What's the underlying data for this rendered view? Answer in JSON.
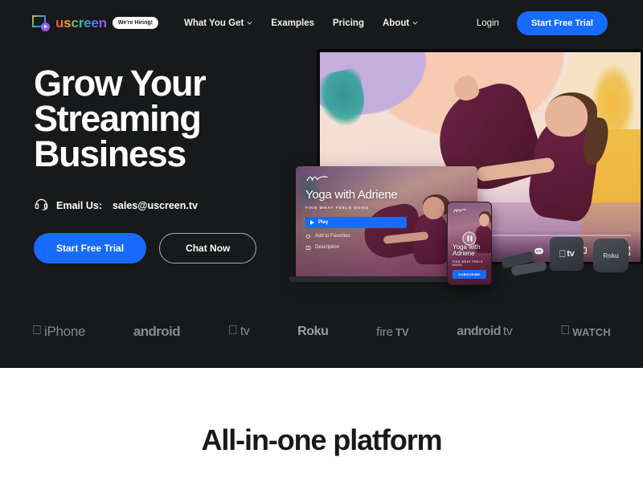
{
  "brand": {
    "name": "uscreen",
    "hiring_badge": "We're Hiring!",
    "logo_icon": "uscreen-play-logo-icon"
  },
  "nav": {
    "items": [
      {
        "label": "What You Get",
        "has_dropdown": true
      },
      {
        "label": "Examples",
        "has_dropdown": false
      },
      {
        "label": "Pricing",
        "has_dropdown": false
      },
      {
        "label": "About",
        "has_dropdown": true
      }
    ],
    "login_label": "Login",
    "cta_label": "Start Free Trial"
  },
  "hero": {
    "title_line1": "Grow Your",
    "title_line2": "Streaming",
    "title_line3": "Business",
    "email_icon": "headset-support-icon",
    "email_label": "Email Us:",
    "email_value": "sales@uscreen.tv",
    "primary_cta": "Start Free Trial",
    "secondary_cta": "Chat Now"
  },
  "showcase": {
    "laptop": {
      "title": "Yoga with Adriene",
      "subtitle": "FIND WHAT FEELS GOOD",
      "play_label": "Play",
      "favorites_label": "Add to Favorites",
      "description_label": "Description"
    },
    "phone": {
      "title": "Yoga with Adriene",
      "subtitle": "FIND WHAT FEELS GOOD",
      "subscribe_label": "SUBSCRIBE"
    },
    "player_controls": [
      "closed-captions-icon",
      "picture-in-picture-icon",
      "cast-icon",
      "settings-gear-icon",
      "fullscreen-icon"
    ],
    "devices": [
      {
        "name": "fire-tv-stick"
      },
      {
        "name": "apple-tv-box",
        "label": "tv"
      },
      {
        "name": "roku-box",
        "label": "Roku"
      }
    ]
  },
  "platforms": [
    {
      "key": "iphone",
      "apple": true,
      "text": "iPhone"
    },
    {
      "key": "android",
      "apple": false,
      "text": "android"
    },
    {
      "key": "apple-tv",
      "apple": true,
      "text": "tv"
    },
    {
      "key": "roku",
      "apple": false,
      "text": "Roku"
    },
    {
      "key": "fire-tv",
      "apple": false,
      "text": "fire",
      "text2": "TV"
    },
    {
      "key": "android-tv",
      "apple": false,
      "text": "android",
      "text2": "tv"
    },
    {
      "key": "apple-watch",
      "apple": true,
      "text": "WATCH"
    }
  ],
  "section": {
    "heading": "All-in-one platform"
  },
  "colors": {
    "dark_bg": "#17191a",
    "accent_blue": "#176bff",
    "white": "#ffffff",
    "muted_logo": "#868a8f"
  }
}
